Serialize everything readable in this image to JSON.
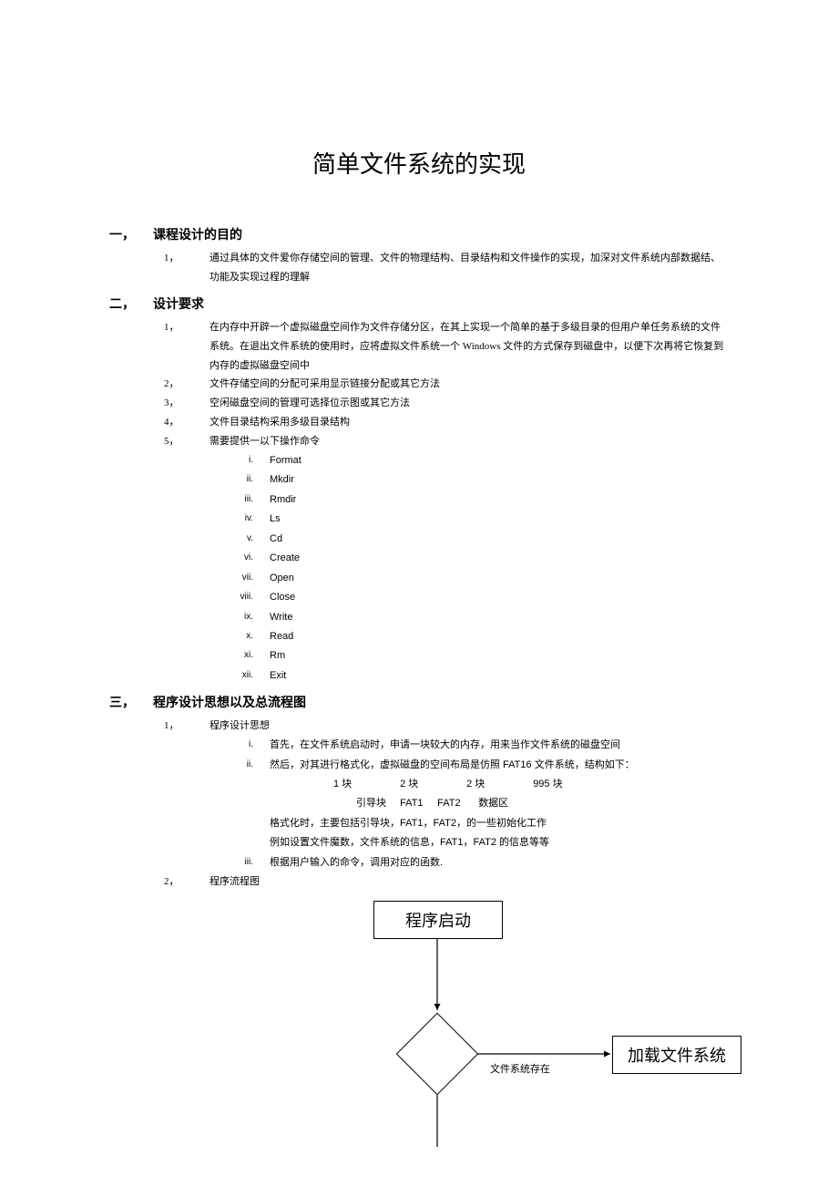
{
  "title": "简单文件系统的实现",
  "sections": [
    {
      "num": "一，",
      "heading": "课程设计的目的",
      "items": [
        {
          "num": "1，",
          "text": "通过具体的文件爱你存储空间的管理、文件的物理结构、目录结构和文件操作的实现，加深对文件系统内部数据结、功能及实现过程的理解"
        }
      ]
    },
    {
      "num": "二，",
      "heading": "设计要求",
      "items": [
        {
          "num": "1，",
          "text": "在内存中开辟一个虚拟磁盘空间作为文件存储分区，在其上实现一个简单的基于多级目录的但用户单任务系统的文件系统。在退出文件系统的使用时，应将虚拟文件系统一个 Windows 文件的方式保存到磁盘中，以便下次再将它恢复到内存的虚拟磁盘空间中"
        },
        {
          "num": "2，",
          "text": "文件存储空间的分配可采用显示链接分配或其它方法"
        },
        {
          "num": "3，",
          "text": "空闲磁盘空间的管理可选择位示图或其它方法"
        },
        {
          "num": "4，",
          "text": "文件目录结构采用多级目录结构"
        },
        {
          "num": "5，",
          "text": "需要提供一以下操作命令",
          "sub": [
            {
              "num": "i.",
              "text": "Format"
            },
            {
              "num": "ii.",
              "text": "Mkdir"
            },
            {
              "num": "iii.",
              "text": "Rmdir"
            },
            {
              "num": "iv.",
              "text": "Ls"
            },
            {
              "num": "v.",
              "text": "Cd"
            },
            {
              "num": "vi.",
              "text": "Create"
            },
            {
              "num": "vii.",
              "text": "Open"
            },
            {
              "num": "viii.",
              "text": "Close"
            },
            {
              "num": "ix.",
              "text": "Write"
            },
            {
              "num": "x.",
              "text": "Read"
            },
            {
              "num": "xi.",
              "text": "Rm"
            },
            {
              "num": "xii.",
              "text": "Exit"
            }
          ]
        }
      ]
    },
    {
      "num": "三，",
      "heading": "程序设计思想以及总流程图",
      "items": [
        {
          "num": "1，",
          "text": "程序设计思想",
          "sub": [
            {
              "num": "i.",
              "text": "首先，在文件系统启动时，申请一块较大的内存，用来当作文件系统的磁盘空间"
            },
            {
              "num": "ii.",
              "text": "然后，对其进行格式化，虚拟磁盘的空间布局是仿照 FAT16 文件系统，结构如下：",
              "extra": [
                {
                  "row1": [
                    "1 块",
                    "2 块",
                    "2 块",
                    "995 块"
                  ]
                },
                {
                  "row2": [
                    "引导块",
                    "FAT1",
                    "FAT2",
                    "数据区"
                  ]
                },
                {
                  "line": "格式化时，主要包括引导块，FAT1，FAT2，的一些初始化工作"
                },
                {
                  "line": "例如设置文件魔数，文件系统的信息，FAT1，FAT2 的信息等等"
                }
              ]
            },
            {
              "num": "iii.",
              "text": "根据用户输入的命令，调用对应的函数."
            }
          ]
        },
        {
          "num": "2，",
          "text": "程序流程图"
        }
      ]
    }
  ],
  "flowchart": {
    "start": "程序启动",
    "load": "加载文件系统",
    "decision_label": "文件系统存在"
  }
}
